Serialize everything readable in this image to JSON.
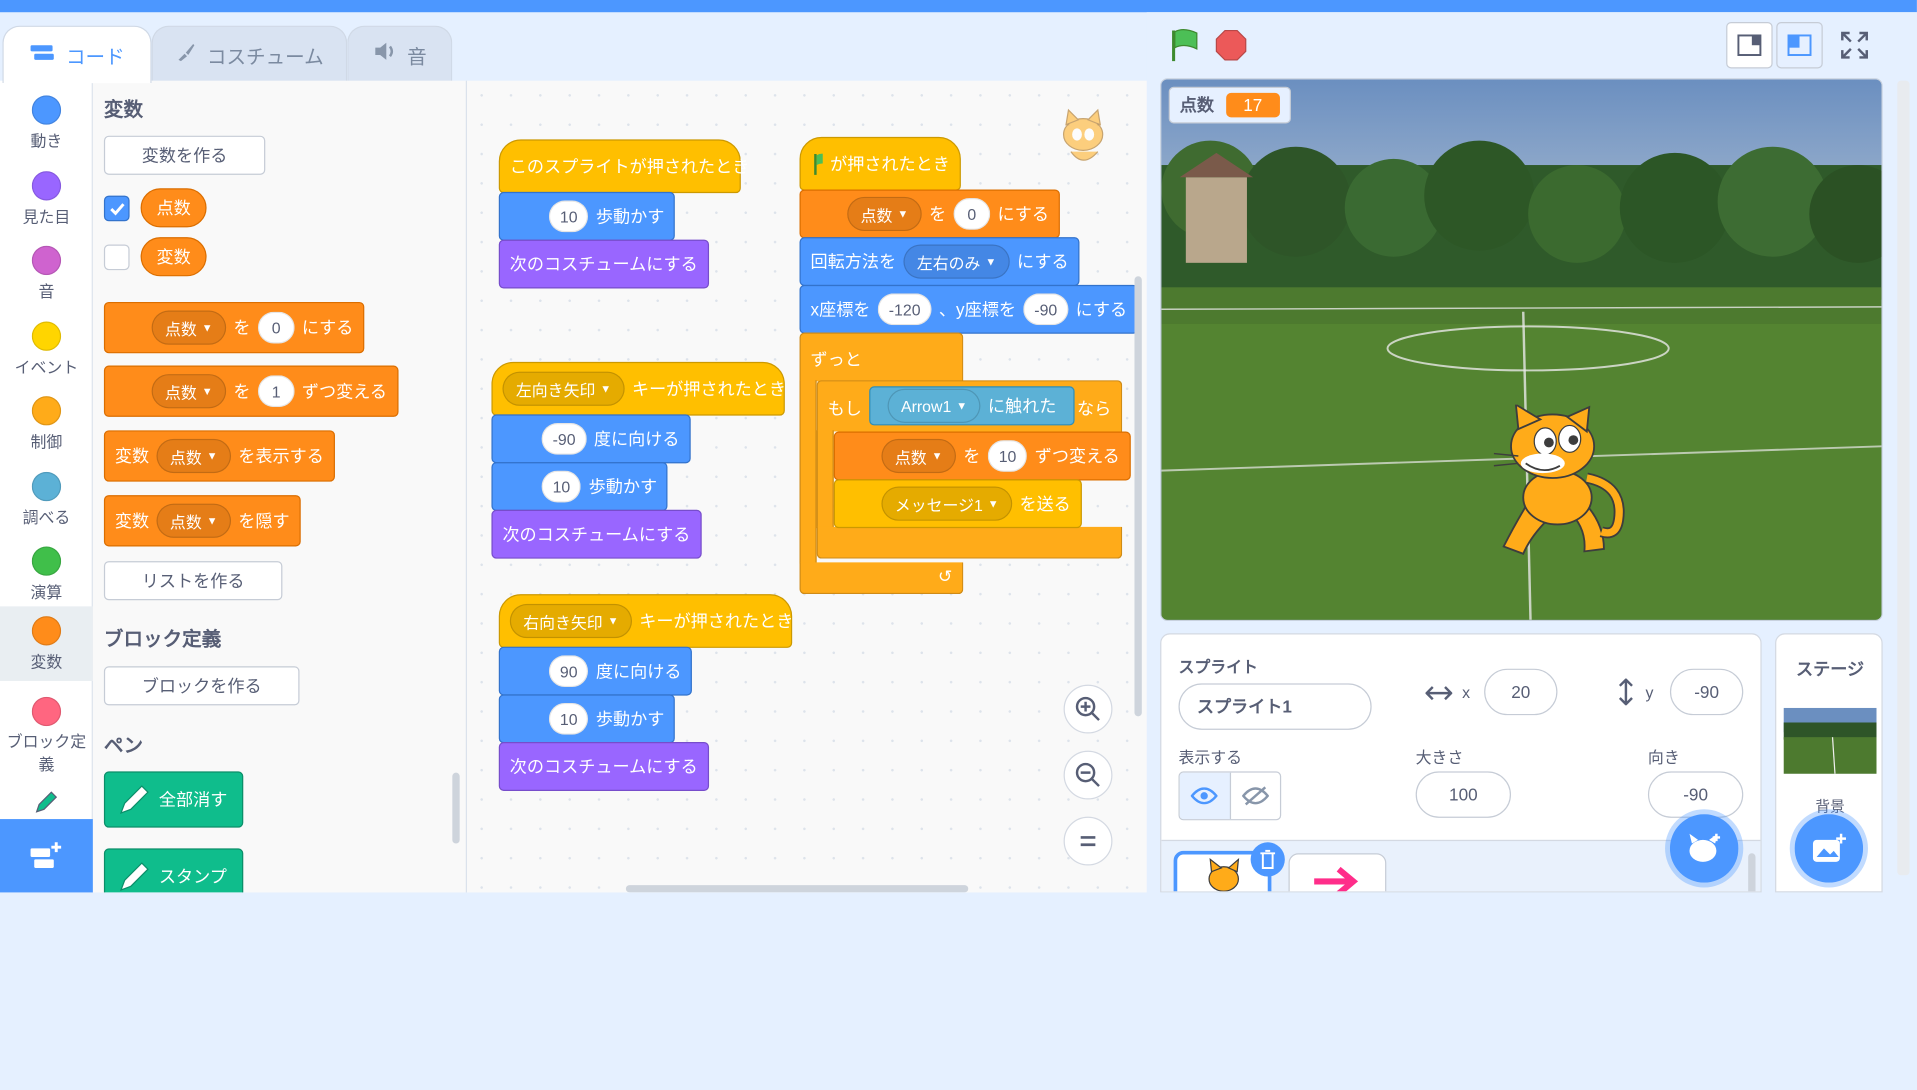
{
  "tabs": {
    "code": "コード",
    "costume": "コスチューム",
    "sound": "音"
  },
  "categories": [
    {
      "label": "動き",
      "color": "#4c97ff"
    },
    {
      "label": "見た目",
      "color": "#9966ff"
    },
    {
      "label": "音",
      "color": "#cf63cf"
    },
    {
      "label": "イベント",
      "color": "#ffd500"
    },
    {
      "label": "制御",
      "color": "#ffab19"
    },
    {
      "label": "調べる",
      "color": "#5cb1d6"
    },
    {
      "label": "演算",
      "color": "#40bf4a"
    },
    {
      "label": "変数",
      "color": "#ff8c1a"
    },
    {
      "label": "ブロック定義",
      "color": "#ff6680"
    }
  ],
  "palette": {
    "heading_variables": "変数",
    "make_variable": "変数を作る",
    "var_score": "点数",
    "var_variable": "変数",
    "set_block": {
      "var": "点数",
      "to": "を",
      "value": "0",
      "suffix": "にする"
    },
    "change_block": {
      "var": "点数",
      "by": "を",
      "value": "1",
      "suffix": "ずつ変える"
    },
    "show_block": {
      "prefix": "変数",
      "var": "点数",
      "suffix": "を表示する"
    },
    "hide_block": {
      "prefix": "変数",
      "var": "点数",
      "suffix": "を隠す"
    },
    "make_list": "リストを作る",
    "heading_myblocks": "ブロック定義",
    "make_block": "ブロックを作る",
    "heading_pen": "ペン",
    "pen_clear": "全部消す",
    "pen_stamp": "スタンプ"
  },
  "script1": {
    "hat": "このスプライトが押されたとき",
    "move_val": "10",
    "move": "歩動かす",
    "next_costume": "次のコスチュームにする"
  },
  "script2": {
    "key": "左向き矢印",
    "hat_suffix": "キーが押されたとき",
    "dir_val": "-90",
    "dir": "度に向ける",
    "move_val": "10",
    "move": "歩動かす",
    "next_costume": "次のコスチュームにする"
  },
  "script3": {
    "key": "右向き矢印",
    "hat_suffix": "キーが押されたとき",
    "dir_val": "90",
    "dir": "度に向ける",
    "move_val": "10",
    "move": "歩動かす",
    "next_costume": "次のコスチュームにする"
  },
  "script4": {
    "hat": "が押されたとき",
    "set_var": "点数",
    "set_to": "を",
    "set_val": "0",
    "set_suffix": "にする",
    "rot_prefix": "回転方法を",
    "rot_val": "左右のみ",
    "rot_suffix": "にする",
    "goto_x": "x座標を",
    "goto_xval": "-120",
    "goto_y": "、y座標を",
    "goto_yval": "-90",
    "goto_suffix": "にする",
    "forever": "ずっと",
    "if_prefix": "もし",
    "touch_val": "Arrow1",
    "touch_suffix": "に触れた",
    "if_then": "なら",
    "chg_var": "点数",
    "chg_to": "を",
    "chg_val": "10",
    "chg_suffix": "ずつ変える",
    "bcast_val": "メッセージ1",
    "bcast_suffix": "を送る"
  },
  "stage": {
    "monitor_label": "点数",
    "monitor_value": "17"
  },
  "sprite_info": {
    "sprite_label": "スプライト",
    "sprite_name": "スプライト1",
    "x_label": "x",
    "x_val": "20",
    "y_label": "y",
    "y_val": "-90",
    "show_label": "表示する",
    "size_label": "大きさ",
    "size_val": "100",
    "direction_label": "向き",
    "direction_val": "-90"
  },
  "stage_panel": {
    "title": "ステージ",
    "backdrop_label": "背景"
  }
}
